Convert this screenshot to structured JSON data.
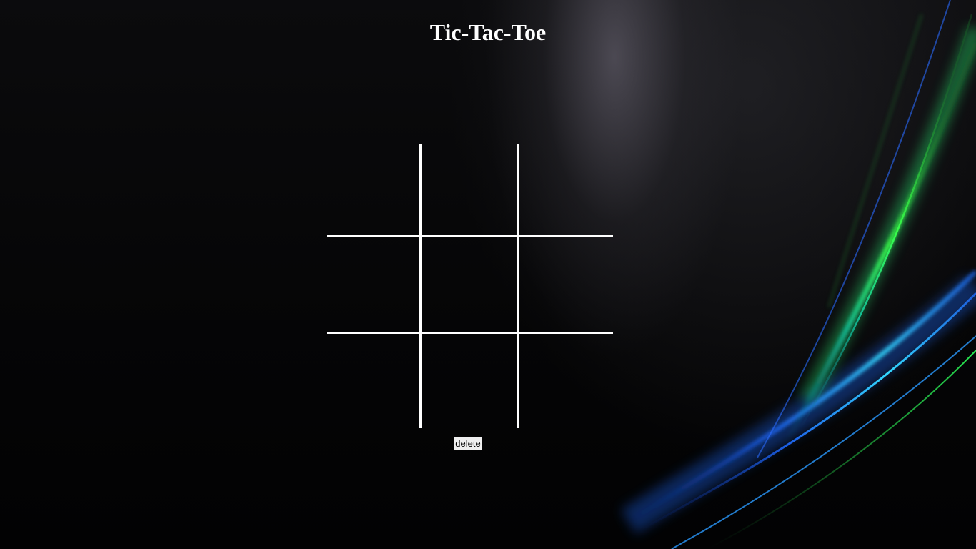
{
  "page": {
    "title": "Tic-Tac-Toe",
    "delete_label": "delete"
  },
  "board": {
    "rows": 3,
    "cols": 3,
    "cells": [
      "",
      "",
      "",
      "",
      "",
      "",
      "",
      "",
      ""
    ]
  },
  "colors": {
    "background": "#000000",
    "grid_line": "#ffffff",
    "title": "#ffffff",
    "accent_blue": "#1f6bff",
    "accent_cyan": "#33d8ff",
    "accent_green": "#39ff4a"
  }
}
